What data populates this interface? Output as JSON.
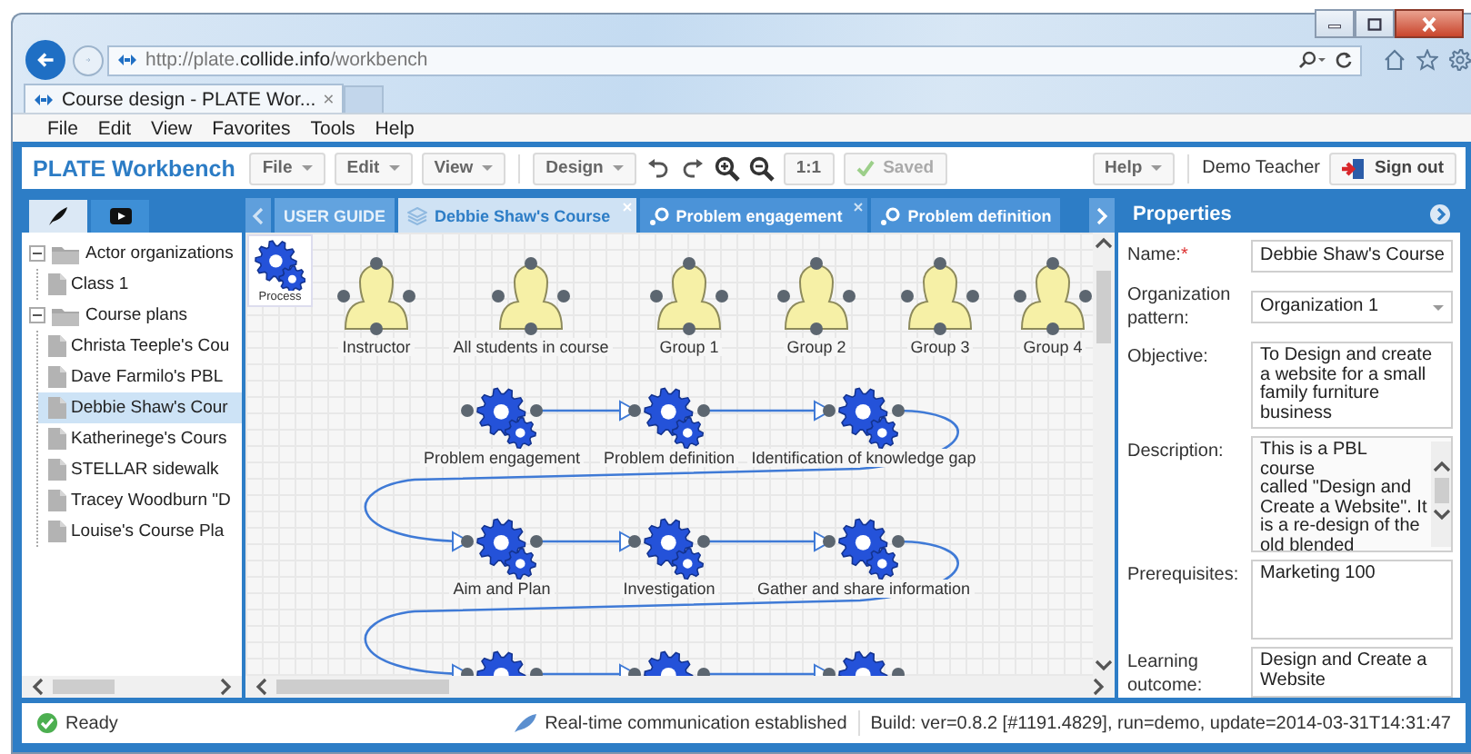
{
  "browser": {
    "address": "http://plate.**collide.info**/workbench",
    "tab_title": "Course design - PLATE Wor...",
    "tab_close": "×",
    "menu": [
      "File",
      "Edit",
      "View",
      "Favorites",
      "Tools",
      "Help"
    ]
  },
  "toolbar": {
    "brand": "PLATE Workbench",
    "left": [
      {
        "kind": "menu",
        "label": "File"
      },
      {
        "kind": "menu",
        "label": "Edit"
      },
      {
        "kind": "menu",
        "label": "View"
      },
      {
        "kind": "separator"
      },
      {
        "kind": "menu",
        "label": "Design"
      },
      {
        "kind": "undo"
      },
      {
        "kind": "redo"
      },
      {
        "kind": "zoom_in"
      },
      {
        "kind": "zoom_out"
      },
      {
        "kind": "button",
        "label": "1:1",
        "disabled": false
      },
      {
        "kind": "status",
        "label": "Saved",
        "disabled": true
      }
    ],
    "right": [
      {
        "kind": "menu",
        "label": "Help"
      },
      {
        "kind": "separator"
      },
      {
        "kind": "text",
        "label": "Demo Teacher"
      },
      {
        "kind": "sign_out",
        "label": "Sign out"
      }
    ]
  },
  "left_panel": {
    "tabs": [
      {
        "kind": "editor",
        "selected": true
      },
      {
        "kind": "video",
        "selected": false
      }
    ],
    "tree": [
      {
        "kind": "folder",
        "label": "Actor organizations",
        "expanded": true,
        "selected": false,
        "children": [
          {
            "kind": "document",
            "label": "Class 1",
            "selected": false
          }
        ]
      },
      {
        "kind": "folder",
        "label": "Course plans",
        "expanded": true,
        "selected": false,
        "children": [
          {
            "kind": "document",
            "label": "Christa Teeple's Cou",
            "selected": false
          },
          {
            "kind": "document",
            "label": "Dave Farmilo's PBL",
            "selected": false
          },
          {
            "kind": "document",
            "label": "Debbie Shaw's Cour",
            "selected": true
          },
          {
            "kind": "document",
            "label": "Katherinege's Cours",
            "selected": false
          },
          {
            "kind": "document",
            "label": "STELLAR sidewalk",
            "selected": false
          },
          {
            "kind": "document",
            "label": "Tracey Woodburn \"D",
            "selected": false
          },
          {
            "kind": "document",
            "label": "Louise's Course Pla",
            "selected": false
          }
        ]
      }
    ]
  },
  "editor_tabs": [
    {
      "kind": "guide",
      "label": "USER GUIDE",
      "selected": false,
      "closable": false
    },
    {
      "kind": "course",
      "label": "Debbie Shaw's Course",
      "selected": true,
      "closable": true
    },
    {
      "kind": "activity",
      "label": "Problem engagement",
      "selected": false,
      "closable": true
    },
    {
      "kind": "activity",
      "label": "Problem definition",
      "selected": false,
      "closable": false
    }
  ],
  "palette": [
    {
      "label": "Process"
    }
  ],
  "diagram": {
    "actors": [
      "Instructor",
      "All students in course",
      "Group 1",
      "Group 2",
      "Group 3",
      "Group 4"
    ],
    "processes": [
      {
        "kind": "process",
        "label": "Problem engagement"
      },
      {
        "kind": "process",
        "label": "Problem definition"
      },
      {
        "kind": "process",
        "label": "Identification of knowledge gap"
      },
      {
        "kind": "process",
        "label": "Aim and Plan"
      },
      {
        "kind": "process",
        "label": "Investigation"
      },
      {
        "kind": "process",
        "label": "Gather and share information"
      },
      {
        "kind": "process"
      },
      {
        "kind": "process"
      },
      {
        "kind": "process"
      }
    ]
  },
  "properties": {
    "title": "Properties",
    "fields": [
      {
        "kind": "text",
        "label": "Name:",
        "required_mark": "*",
        "value": "Debbie Shaw's Course"
      },
      {
        "kind": "select",
        "label": "Organization pattern:",
        "value": "Organization 1"
      },
      {
        "kind": "textarea",
        "label": "Objective:",
        "value": "To Design and create a website for a small family furniture business",
        "scrollable": false
      },
      {
        "kind": "textarea",
        "label": "Description:",
        "value": "This is a PBL\ncourse\ncalled \"Design and Create a Website\". It is a re-design of the old blended",
        "scrollable": true
      },
      {
        "kind": "textarea",
        "label": "Prerequisites:",
        "value": "Marketing 100",
        "scrollable": false
      },
      {
        "kind": "textarea",
        "label": "Learning outcome:",
        "value": "Design and Create a Website",
        "scrollable": false
      }
    ]
  },
  "status_bar": {
    "state": "Ready",
    "connection": "Real-time communication established",
    "build": "Build: ver=0.8.2 [#1191.4829], run=demo, update=2014-03-31T14:31:47"
  }
}
